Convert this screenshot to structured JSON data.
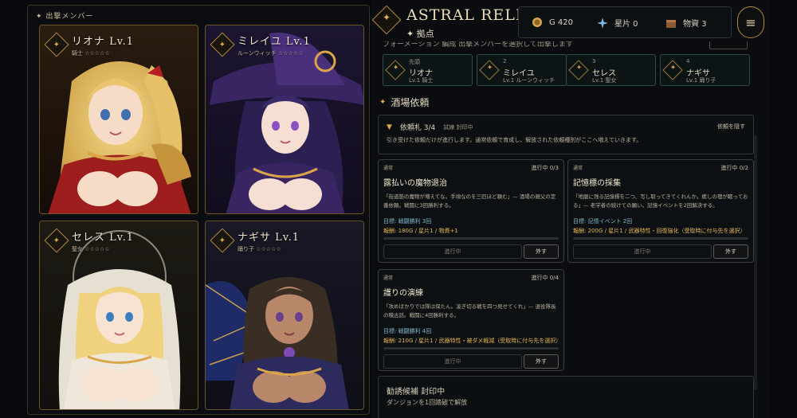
{
  "party": {
    "title": "✦ 出撃メンバー",
    "members": [
      {
        "name": "リオナ Lv.1",
        "sub": "騎士 ☆☆☆☆☆"
      },
      {
        "name": "ミレイユ Lv.1",
        "sub": "ルーンウィッチ ☆☆☆☆☆"
      },
      {
        "name": "セレス Lv.1",
        "sub": "聖女 ☆☆☆☆☆"
      },
      {
        "name": "ナギサ Lv.1",
        "sub": "踊り子 ☆☆☆☆☆"
      }
    ]
  },
  "header": {
    "title": "ASTRAL RELIC",
    "subtitle": "✦ 拠点",
    "resources": {
      "gold": "G 420",
      "stars": "星片 0",
      "materials": "物資 3"
    },
    "menu_icon": "≡"
  },
  "formation": {
    "cut_text": "フォーメーション 編成  出撃メンバーを選択して出撃します",
    "slots": [
      {
        "index": "先頭",
        "name": "リオナ",
        "sub": "Lv.1 騎士"
      },
      {
        "index": "2",
        "name": "ミレイユ",
        "sub": "Lv.1 ルーンウィッチ"
      },
      {
        "index": "3",
        "name": "セレス",
        "sub": "Lv.1 聖女"
      },
      {
        "index": "4",
        "name": "ナギサ",
        "sub": "Lv.1 踊り子"
      }
    ]
  },
  "tavern": {
    "title": "酒場依頼",
    "ticket_title": "依頼札 3/4",
    "ticket_status": "試練 封印中",
    "ticket_hide": "依頼を隠す",
    "ticket_desc": "引き受けた依頼だけが進行します。通常依頼で育成し、解放された依頼種別がここへ増えていきます。",
    "quests": [
      {
        "tag": "通常",
        "progress": "進行中 0/3",
        "title": "露払いの魔物退治",
        "desc": "「街道筋の魔物が増えてな。手頃なのを三匹ほど頼む」— 酒場の親父の定番依頼。戦闘に3回勝利する。",
        "goal": "目標: 戦闘勝利 3回",
        "reward": "報酬: 180G / 星片1 / 物資+1",
        "run_label": "進行中",
        "off_label": "外す",
        "fill": 0
      },
      {
        "tag": "通常",
        "progress": "進行中 0/2",
        "title": "記憶標の採集",
        "desc": "「地脈に残る記憶標を二つ、写し取ってきてくれんか。癒しの理が眠っておる」— 老学者の続けての願い。記憶イベントを2回解決する。",
        "goal": "目標: 記憶イベント 2回",
        "reward": "報酬: 200G / 星片1 / 武器特性・回復強化（受取時に付与先を選択）",
        "run_label": "進行中",
        "off_label": "外す",
        "fill": 0
      },
      {
        "tag": "通常",
        "progress": "進行中 0/4",
        "title": "護りの演練",
        "desc": "「攻めばかりでは隊は保たん。凌ぎ切る戦を四つ見せてくれ」— 退役隊長の稽古話。戦闘に4回勝利する。",
        "goal": "目標: 戦闘勝利 4回",
        "reward": "報酬: 210G / 星片1 / 武器特性・被ダメ軽減（受取時に付与先を選択）",
        "run_label": "進行中",
        "off_label": "外す",
        "fill": 0
      }
    ],
    "recruit_title": "勧誘候補  封印中",
    "recruit_desc": "ダンジョンを1回踏破で解放"
  },
  "colors": {
    "gold_accent": "#d9a548",
    "teal_border": "#2f4b4e",
    "reward_text": "#e4b552",
    "goal_text": "#7fb5c9"
  },
  "icons": [
    "shield-emblem-icon",
    "gold-coin-icon",
    "star-shard-icon",
    "supply-crate-icon",
    "hamburger-menu-icon",
    "triangle-down-icon"
  ]
}
